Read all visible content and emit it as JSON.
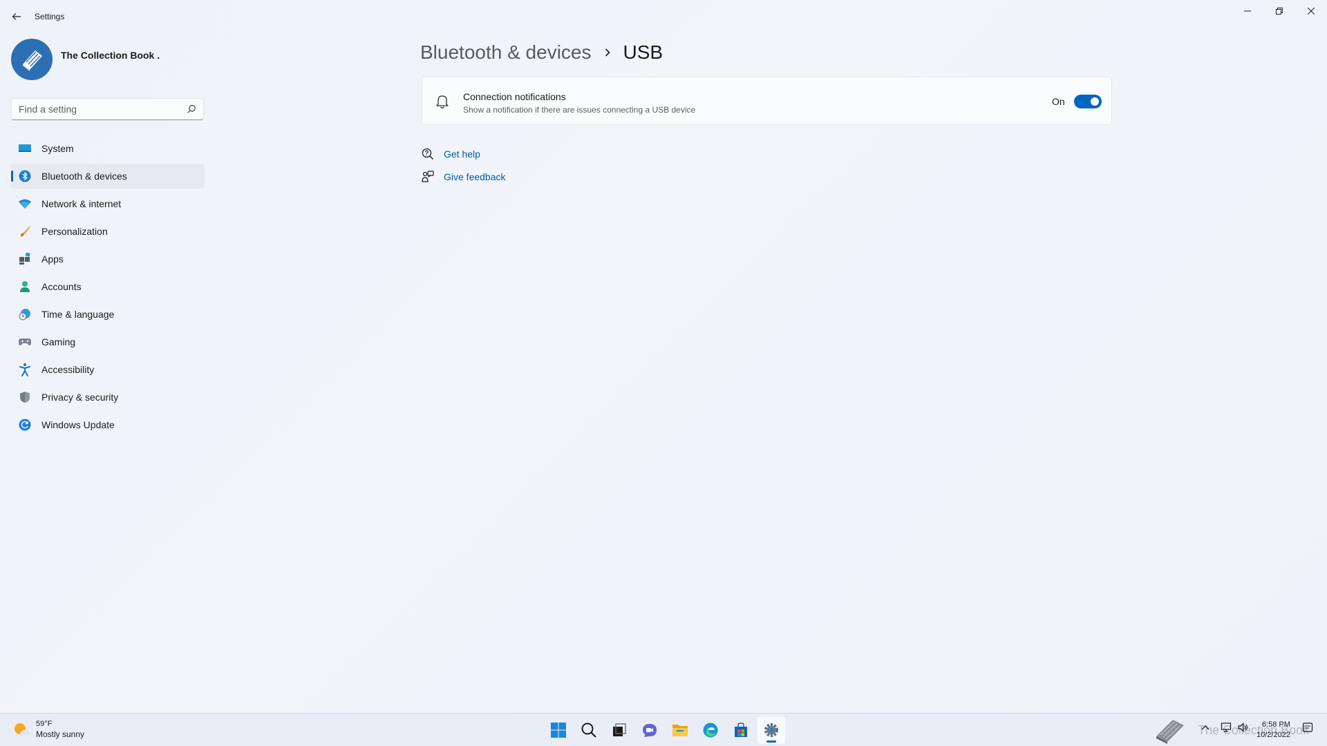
{
  "window": {
    "title": "Settings",
    "back_icon": "back-arrow-icon",
    "controls": [
      "minimize-icon",
      "restore-icon",
      "close-icon"
    ]
  },
  "profile": {
    "name": "The Collection Book ."
  },
  "search": {
    "placeholder": "Find a setting",
    "value": ""
  },
  "sidebar": {
    "items": [
      {
        "label": "System",
        "icon": "system-icon"
      },
      {
        "label": "Bluetooth & devices",
        "icon": "bluetooth-icon",
        "active": true
      },
      {
        "label": "Network & internet",
        "icon": "wifi-icon"
      },
      {
        "label": "Personalization",
        "icon": "brush-icon"
      },
      {
        "label": "Apps",
        "icon": "apps-icon"
      },
      {
        "label": "Accounts",
        "icon": "person-icon"
      },
      {
        "label": "Time & language",
        "icon": "globe-clock-icon"
      },
      {
        "label": "Gaming",
        "icon": "gamepad-icon"
      },
      {
        "label": "Accessibility",
        "icon": "accessibility-icon"
      },
      {
        "label": "Privacy & security",
        "icon": "shield-icon"
      },
      {
        "label": "Windows Update",
        "icon": "update-icon"
      }
    ]
  },
  "main": {
    "breadcrumb_parent": "Bluetooth & devices",
    "breadcrumb_current": "USB",
    "setting": {
      "title": "Connection notifications",
      "description": "Show a notification if there are issues connecting a USB device",
      "toggle_label": "On",
      "toggle_on": true
    },
    "links": [
      {
        "label": "Get help",
        "icon": "help-icon"
      },
      {
        "label": "Give feedback",
        "icon": "feedback-icon"
      }
    ]
  },
  "taskbar": {
    "weather_temp": "59°F",
    "weather_condition": "Mostly sunny",
    "apps": [
      "start-icon",
      "search-icon",
      "task-view-icon",
      "chat-icon",
      "file-explorer-icon",
      "edge-icon",
      "store-icon",
      "settings-icon"
    ],
    "watermark": "The Collection Book",
    "time": "6:58 PM",
    "date": "10/2/2022"
  },
  "colors": {
    "accent": "#0067c0",
    "link": "#005a9e"
  }
}
